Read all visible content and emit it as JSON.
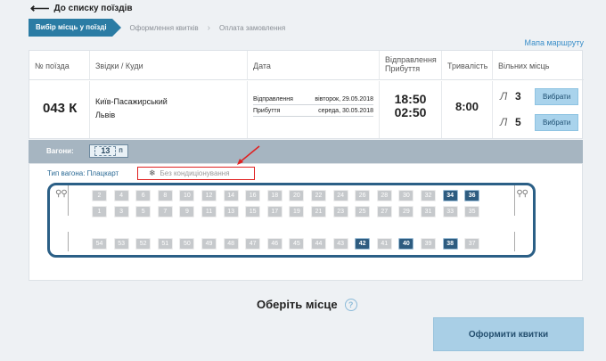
{
  "back_link": "До списку поїздів",
  "steps": [
    "Вибір місць у поїзді",
    "Оформлення квитків",
    "Оплата замовлення"
  ],
  "route_map": "Мапа маршруту",
  "table": {
    "headers": {
      "train_no": "№ поїзда",
      "from_to": "Звідки / Куди",
      "date": "Дата",
      "depart_arrive_1": "Відправлення",
      "depart_arrive_2": "Прибуття",
      "duration": "Тривалість",
      "free_seats": "Вільних місць"
    },
    "train": {
      "number": "043 К",
      "from": "Київ-Пасажирський",
      "to": "Львів",
      "depart_label": "Відправлення",
      "depart_date": "вівторок, 29.05.2018",
      "arrive_label": "Прибуття",
      "arrive_date": "середа, 30.05.2018",
      "depart_time": "18:50",
      "arrive_time": "02:50",
      "duration": "8:00",
      "seat_classes": [
        {
          "icon": "Л",
          "count": "3",
          "button": "Вибрати"
        },
        {
          "icon": "Л",
          "count": "5",
          "button": "Вибрати"
        }
      ]
    }
  },
  "wagons": {
    "label": "Вагони:",
    "selected": "13",
    "class_mark": "П"
  },
  "wagon_type": "Тип вагона: Плацкарт",
  "no_ac": "Без кондиціонування",
  "seats_top_row": [
    "2",
    "4",
    "6",
    "8",
    "10",
    "12",
    "14",
    "16",
    "18",
    "20",
    "22",
    "24",
    "26",
    "28",
    "30",
    "32",
    "34",
    "36"
  ],
  "seats_mid_row": [
    "1",
    "3",
    "5",
    "7",
    "9",
    "11",
    "13",
    "15",
    "17",
    "19",
    "21",
    "23",
    "25",
    "27",
    "29",
    "31",
    "33",
    "35"
  ],
  "seats_bottom_row": [
    "54",
    "53",
    "52",
    "51",
    "50",
    "49",
    "48",
    "47",
    "46",
    "45",
    "44",
    "43",
    "42",
    "41",
    "40",
    "39",
    "38",
    "37"
  ],
  "free_seats": [
    "34",
    "36",
    "42",
    "40",
    "38"
  ],
  "choose_place": "Оберіть місце",
  "help": "?",
  "submit": "Оформити квитки"
}
